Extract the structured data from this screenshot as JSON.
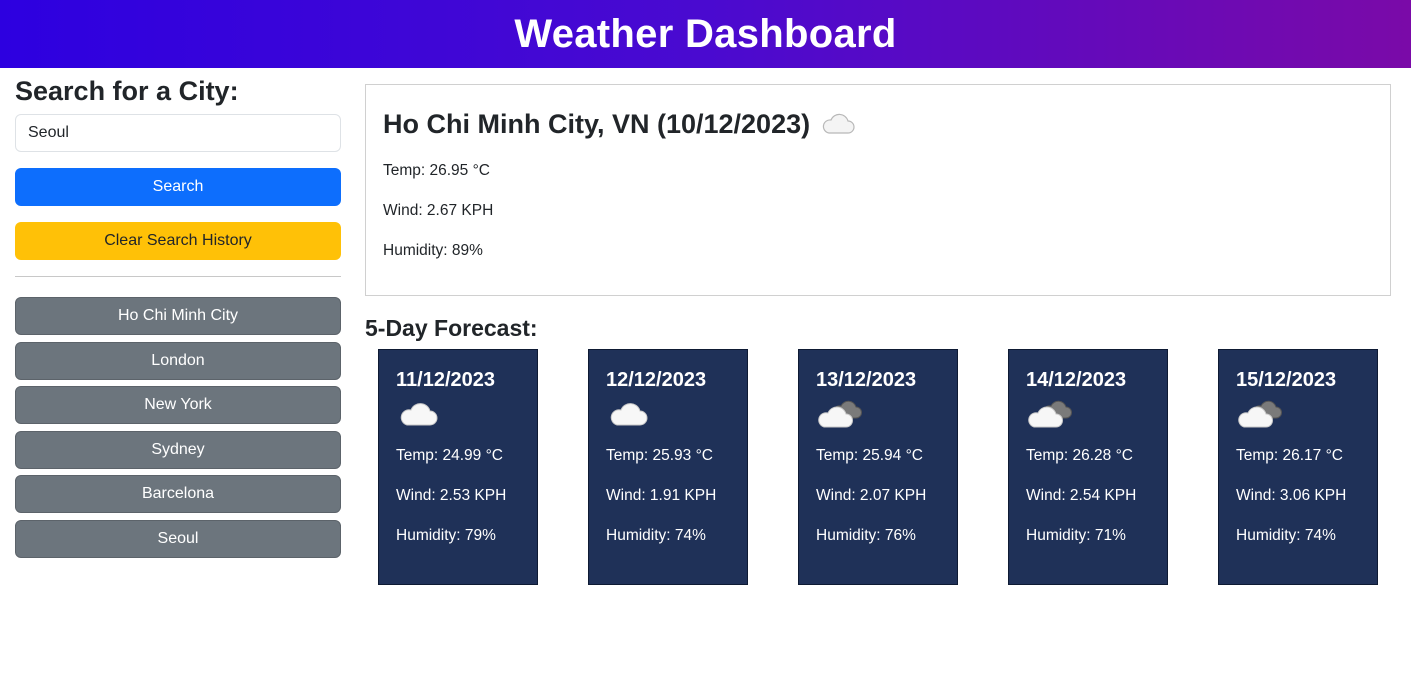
{
  "header": {
    "title": "Weather Dashboard"
  },
  "sidebar": {
    "heading": "Search for a City:",
    "search_value": "Seoul",
    "search_button": "Search",
    "clear_button": "Clear Search History",
    "history": [
      "Ho Chi Minh City",
      "London",
      "New York",
      "Sydney",
      "Barcelona",
      "Seoul"
    ]
  },
  "current": {
    "title": "Ho Chi Minh City, VN (10/12/2023)",
    "icon": "cloud-icon",
    "temp": "Temp: 26.95 °C",
    "wind": "Wind: 2.67 KPH",
    "humidity": "Humidity: 89%"
  },
  "forecast": {
    "heading": "5-Day Forecast:",
    "days": [
      {
        "date": "11/12/2023",
        "icon": "cloud-icon",
        "temp": "Temp: 24.99 °C",
        "wind": "Wind: 2.53 KPH",
        "humidity": "Humidity: 79%"
      },
      {
        "date": "12/12/2023",
        "icon": "cloud-icon",
        "temp": "Temp: 25.93 °C",
        "wind": "Wind: 1.91 KPH",
        "humidity": "Humidity: 74%"
      },
      {
        "date": "13/12/2023",
        "icon": "broken-clouds-icon",
        "temp": "Temp: 25.94 °C",
        "wind": "Wind: 2.07 KPH",
        "humidity": "Humidity: 76%"
      },
      {
        "date": "14/12/2023",
        "icon": "broken-clouds-icon",
        "temp": "Temp: 26.28 °C",
        "wind": "Wind: 2.54 KPH",
        "humidity": "Humidity: 71%"
      },
      {
        "date": "15/12/2023",
        "icon": "broken-clouds-icon",
        "temp": "Temp: 26.17 °C",
        "wind": "Wind: 3.06 KPH",
        "humidity": "Humidity: 74%"
      }
    ]
  },
  "colors": {
    "header_gradient_start": "#2d00e0",
    "header_gradient_end": "#7a0aa8",
    "search_button": "#0d6efd",
    "clear_button": "#ffc107",
    "history_button": "#6c757d",
    "forecast_card": "#1f3158"
  }
}
